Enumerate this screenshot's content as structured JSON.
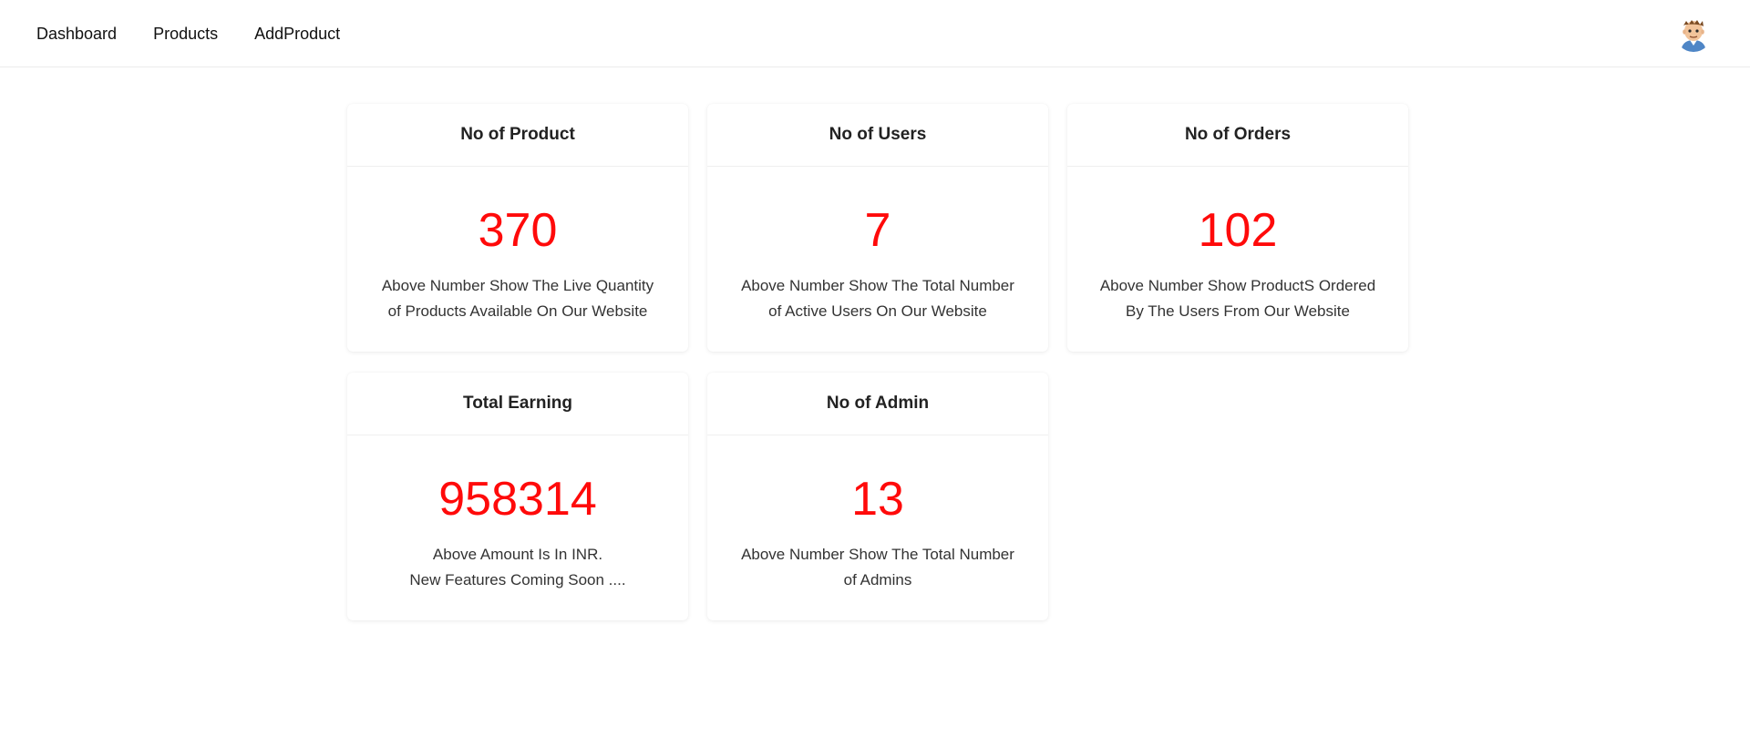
{
  "nav": {
    "links": [
      "Dashboard",
      "Products",
      "AddProduct"
    ]
  },
  "avatar": {
    "icon": "cartoon-person-avatar"
  },
  "colors": {
    "value": "#ff0a0a",
    "header_text": "#222222"
  },
  "cards": [
    {
      "title": "No of Product",
      "value": "370",
      "desc_line1": "Above Number Show The Live Quantity",
      "desc_line2": "of Products Available On Our Website"
    },
    {
      "title": "No of Users",
      "value": "7",
      "desc_line1": "Above Number Show The Total Number",
      "desc_line2": "of Active Users On Our Website"
    },
    {
      "title": "No of Orders",
      "value": "102",
      "desc_line1": "Above Number Show ProductS Ordered",
      "desc_line2": "By The Users From Our Website"
    },
    {
      "title": "Total Earning",
      "value": "958314",
      "desc_line1": "Above Amount Is In INR.",
      "desc_line2": "New Features Coming Soon ...."
    },
    {
      "title": "No of Admin",
      "value": "13",
      "desc_line1": "Above Number Show The Total Number",
      "desc_line2": "of Admins"
    }
  ]
}
